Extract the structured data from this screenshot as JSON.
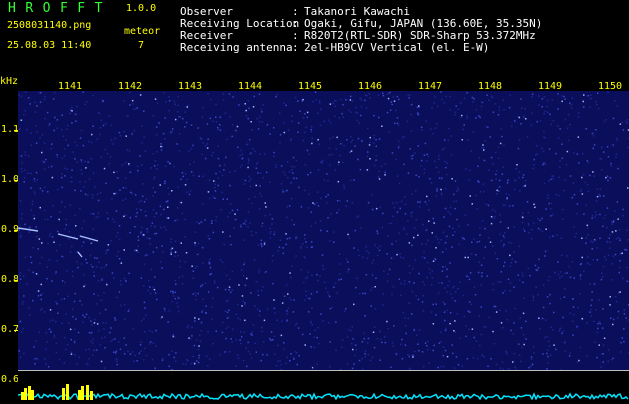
{
  "header": {
    "app_title": "HROFFT",
    "app_version": "1.0.0",
    "file_name": "2508031140.png",
    "meteor_label": "meteor",
    "date_time": "25.08.03 11:40",
    "meteor_count": "7"
  },
  "info": [
    {
      "label": "Observer",
      "value": "Takanori Kawachi"
    },
    {
      "label": "Receiving Location",
      "value": "Ogaki, Gifu, JAPAN (136.60E, 35.35N)"
    },
    {
      "label": "Receiver",
      "value": "R820T2(RTL-SDR) SDR-Sharp 53.372MHz"
    },
    {
      "label": "Receiving antenna",
      "value": "2el-HB9CV Vertical (el. E-W)"
    }
  ],
  "axis": {
    "y_unit": "kHz",
    "x_ticks": [
      "1141",
      "1142",
      "1143",
      "1144",
      "1145",
      "1146",
      "1147",
      "1148",
      "1149",
      "1150"
    ],
    "y_ticks": [
      "1.1",
      "1.0",
      "0.9",
      "0.8",
      "0.7",
      "0.6"
    ]
  },
  "colors": {
    "background": "#000000",
    "waterfall": "#0b0e5a",
    "label_yellow": "#ffff00",
    "title_green": "#33ff33",
    "spectrum": "#00e5ff"
  }
}
